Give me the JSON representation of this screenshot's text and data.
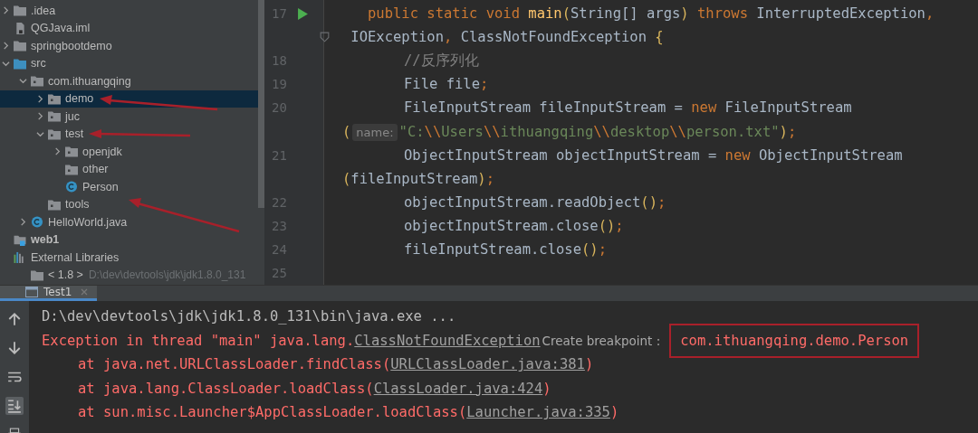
{
  "project_tree": {
    "items": [
      {
        "label": ".idea",
        "kind": "folder",
        "expanded": false,
        "selected": false
      },
      {
        "label": "QGJava.iml",
        "kind": "iml",
        "selected": false
      },
      {
        "label": "springbootdemo",
        "kind": "folder",
        "expanded": false,
        "selected": false
      },
      {
        "label": "src",
        "kind": "source",
        "expanded": true,
        "selected": false,
        "children": [
          {
            "label": "com.ithuangqing",
            "kind": "package",
            "expanded": true,
            "selected": false,
            "children": [
              {
                "label": "demo",
                "kind": "package",
                "expanded": false,
                "selected": true
              },
              {
                "label": "juc",
                "kind": "package",
                "expanded": false,
                "selected": false
              },
              {
                "label": "test",
                "kind": "package",
                "expanded": true,
                "selected": false,
                "children": [
                  {
                    "label": "openjdk",
                    "kind": "package",
                    "expanded": false,
                    "selected": false
                  },
                  {
                    "label": "other",
                    "kind": "package",
                    "selected": false
                  },
                  {
                    "label": "Person",
                    "kind": "class",
                    "selected": false
                  }
                ]
              },
              {
                "label": "tools",
                "kind": "package",
                "selected": false
              }
            ]
          },
          {
            "label": "HelloWorld.java",
            "kind": "java",
            "expanded": false,
            "selected": false
          }
        ]
      },
      {
        "label": "web1",
        "kind": "module",
        "selected": false
      },
      {
        "label": "External Libraries",
        "kind": "libraries",
        "selected": false,
        "children": [
          {
            "label": "< 1.8 >",
            "detail": "D:\\dev\\devtools\\jdk\\jdk1.8.0_131",
            "kind": "sdk",
            "selected": false
          }
        ]
      }
    ]
  },
  "editor": {
    "lines": [
      {
        "number": "17",
        "kind": "signature",
        "run": true,
        "tokens": [
          {
            "kind": "keyword",
            "text": "public static void "
          },
          {
            "kind": "method",
            "text": "main"
          },
          {
            "kind": "paren",
            "text": "("
          },
          {
            "kind": "plain",
            "text": "String[] args"
          },
          {
            "kind": "paren",
            "text": ")"
          },
          {
            "kind": "keyword",
            "text": " throws "
          },
          {
            "kind": "plain",
            "text": "InterruptedException"
          },
          {
            "kind": "punct",
            "text": ","
          }
        ]
      },
      {
        "kind": "continuation",
        "fold": true,
        "tokens": [
          {
            "kind": "plain",
            "text": " IOException"
          },
          {
            "kind": "punct",
            "text": ","
          },
          {
            "kind": "plain",
            "text": " ClassNotFoundException "
          },
          {
            "kind": "paren",
            "text": "{"
          }
        ]
      },
      {
        "number": "18",
        "kind": "statement",
        "tokens": [
          {
            "kind": "comment",
            "text": "//反序列化"
          }
        ]
      },
      {
        "number": "19",
        "kind": "statement",
        "tokens": [
          {
            "kind": "plain",
            "text": "File file"
          },
          {
            "kind": "punct",
            "text": ";"
          }
        ]
      },
      {
        "number": "20",
        "kind": "statement",
        "tokens": [
          {
            "kind": "plain",
            "text": "FileInputStream fileInputStream = "
          },
          {
            "kind": "keyword",
            "text": "new"
          },
          {
            "kind": "plain",
            "text": " FileInputStream"
          }
        ]
      },
      {
        "kind": "continuation",
        "tokens": [
          {
            "kind": "paren",
            "text": "("
          },
          {
            "kind": "hint",
            "text": "name:"
          },
          {
            "kind": "string",
            "text": "\"C:"
          },
          {
            "kind": "escape",
            "text": "\\\\"
          },
          {
            "kind": "string",
            "text": "Users"
          },
          {
            "kind": "escape",
            "text": "\\\\"
          },
          {
            "kind": "string",
            "text": "ithuangqing"
          },
          {
            "kind": "escape",
            "text": "\\\\"
          },
          {
            "kind": "string",
            "text": "desktop"
          },
          {
            "kind": "escape",
            "text": "\\\\"
          },
          {
            "kind": "string",
            "text": "person.txt\""
          },
          {
            "kind": "paren",
            "text": ")"
          },
          {
            "kind": "punct",
            "text": ";"
          }
        ]
      },
      {
        "number": "21",
        "kind": "statement",
        "tokens": [
          {
            "kind": "plain",
            "text": "ObjectInputStream objectInputStream = "
          },
          {
            "kind": "keyword",
            "text": "new"
          },
          {
            "kind": "plain",
            "text": " ObjectInputStream"
          }
        ]
      },
      {
        "kind": "continuation",
        "tokens": [
          {
            "kind": "paren",
            "text": "("
          },
          {
            "kind": "plain",
            "text": "fileInputStream"
          },
          {
            "kind": "paren",
            "text": ")"
          },
          {
            "kind": "punct",
            "text": ";"
          }
        ]
      },
      {
        "number": "22",
        "kind": "statement",
        "tokens": [
          {
            "kind": "plain",
            "text": "objectInputStream.readObject"
          },
          {
            "kind": "paren",
            "text": "()"
          },
          {
            "kind": "punct",
            "text": ";"
          }
        ]
      },
      {
        "number": "23",
        "kind": "statement",
        "tokens": [
          {
            "kind": "plain",
            "text": "objectInputStream.close"
          },
          {
            "kind": "paren",
            "text": "()"
          },
          {
            "kind": "punct",
            "text": ";"
          }
        ]
      },
      {
        "number": "24",
        "kind": "statement",
        "tokens": [
          {
            "kind": "plain",
            "text": "fileInputStream.close"
          },
          {
            "kind": "paren",
            "text": "()"
          },
          {
            "kind": "punct",
            "text": ";"
          }
        ]
      },
      {
        "number": "25",
        "kind": "statement"
      }
    ]
  },
  "run_panel": {
    "tabs": [
      {
        "label": "Test1",
        "selected": true
      }
    ],
    "console": [
      {
        "kind": "command",
        "tokens": [
          {
            "kind": "plain",
            "text": "D:\\dev\\devtools\\jdk\\jdk1.8.0_131\\bin\\java.exe ..."
          }
        ]
      },
      {
        "kind": "error",
        "tokens": [
          {
            "kind": "plain",
            "text": "Exception in thread \"main\" java.lang."
          },
          {
            "kind": "link",
            "text": "ClassNotFoundException"
          },
          {
            "kind": "hint",
            "text": "Create breakpoint :"
          },
          {
            "kind": "boxed",
            "text": "com.ithuangqing.demo.Person"
          }
        ]
      },
      {
        "kind": "stack",
        "tokens": [
          {
            "kind": "plain",
            "text": "at java.net.URLClassLoader.findClass("
          },
          {
            "kind": "link",
            "text": "URLClassLoader.java:381"
          },
          {
            "kind": "plain",
            "text": ")"
          }
        ]
      },
      {
        "kind": "stack",
        "tokens": [
          {
            "kind": "plain",
            "text": "at java.lang.ClassLoader.loadClass("
          },
          {
            "kind": "link",
            "text": "ClassLoader.java:424"
          },
          {
            "kind": "plain",
            "text": ")"
          }
        ]
      },
      {
        "kind": "stack",
        "tokens": [
          {
            "kind": "plain",
            "text": "at sun.misc.Launcher$AppClassLoader.loadClass("
          },
          {
            "kind": "link",
            "text": "Launcher.java:335"
          },
          {
            "kind": "plain",
            "text": ")"
          }
        ]
      }
    ]
  }
}
